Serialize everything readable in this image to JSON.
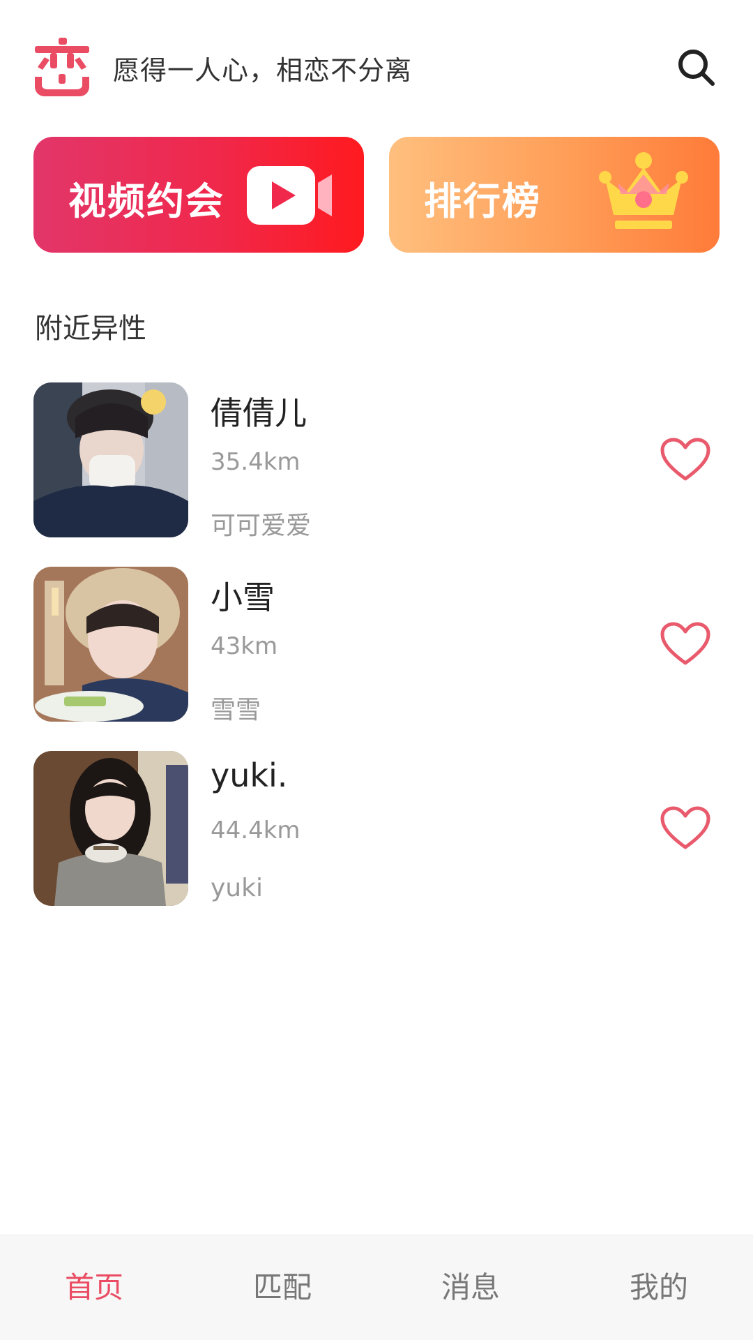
{
  "header": {
    "slogan": "愿得一人心，相恋不分离",
    "logo_icon": "lian-logo-icon",
    "search_icon": "search-icon"
  },
  "features": [
    {
      "label": "视频约会",
      "icon": "video-camera-icon"
    },
    {
      "label": "排行榜",
      "icon": "crown-icon"
    }
  ],
  "section": {
    "title": "附近异性"
  },
  "users": [
    {
      "name": "倩倩儿",
      "distance": "35.4km",
      "signature": "可可爱爱"
    },
    {
      "name": "小雪",
      "distance": "43km",
      "signature": "雪雪"
    },
    {
      "name": "yuki.",
      "distance": "44.4km",
      "signature": "yuki"
    }
  ],
  "tabbar": {
    "tabs": [
      "首页",
      "匹配",
      "消息",
      "我的"
    ],
    "active_index": 0
  },
  "colors": {
    "brand": "#e94c63",
    "video_gradient_start": "#e2366a",
    "video_gradient_end": "#ff1a1f",
    "rank_gradient_start": "#ffbf7e",
    "rank_gradient_end": "#ff7b39"
  }
}
